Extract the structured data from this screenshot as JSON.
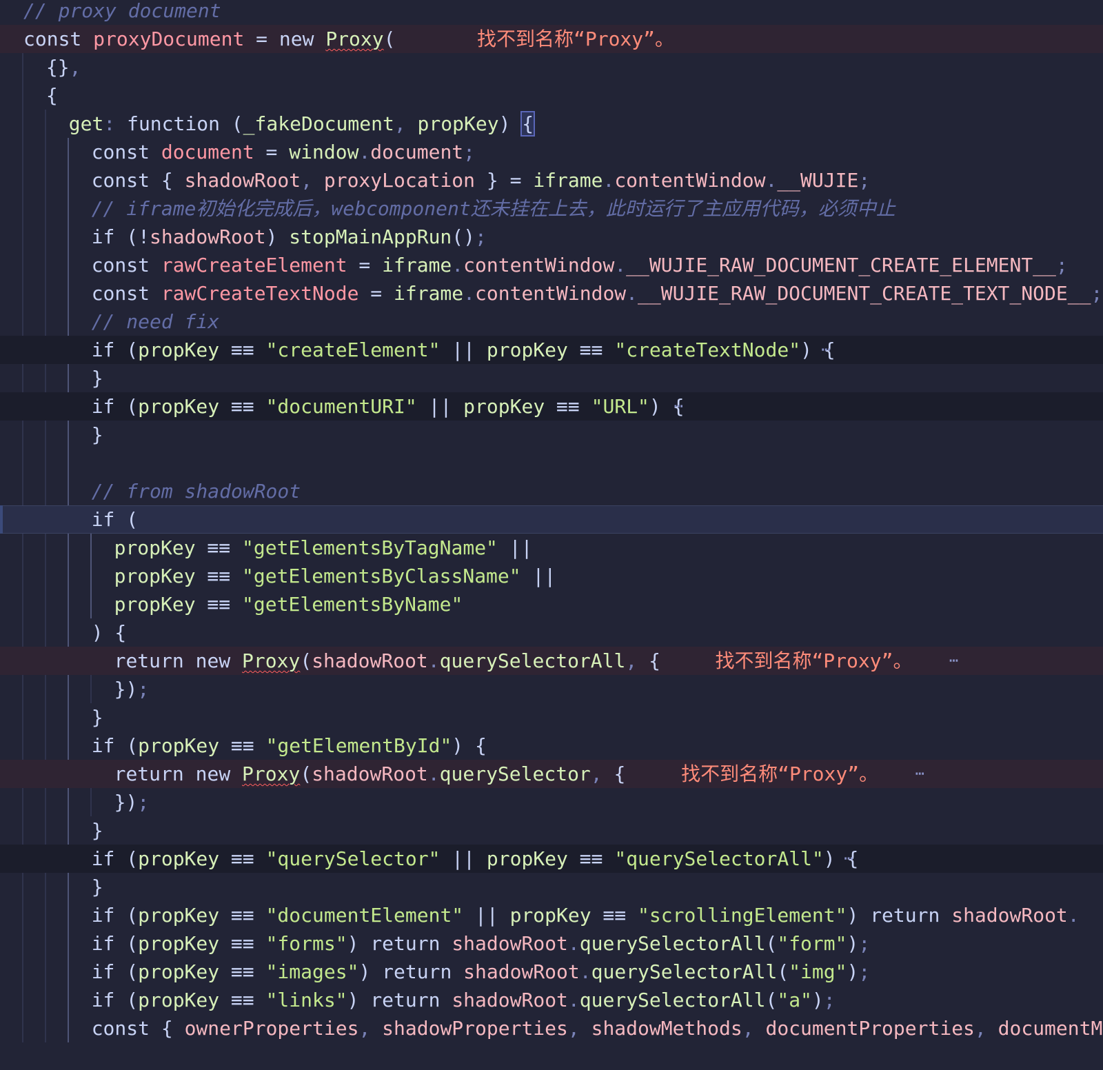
{
  "editor": {
    "language": "javascript",
    "error_message": "找不到名称“Proxy”。",
    "fold_marker": "⋯",
    "lines": [
      {
        "t": "// proxy document"
      },
      {
        "t": "const proxyDocument = new Proxy("
      },
      {
        "t": "{},"
      },
      {
        "t": "{"
      },
      {
        "t": "get: function (_fakeDocument, propKey) {"
      },
      {
        "t": "const document = window.document;"
      },
      {
        "t": "const { shadowRoot, proxyLocation } = iframe.contentWindow.__WUJIE;"
      },
      {
        "t": "// iframe初始化完成后，webcomponent还未挂在上去，此时运行了主应用代码，必须中止"
      },
      {
        "t": "if (!shadowRoot) stopMainAppRun();"
      },
      {
        "t": "const rawCreateElement = iframe.contentWindow.__WUJIE_RAW_DOCUMENT_CREATE_ELEMENT__;"
      },
      {
        "t": "const rawCreateTextNode = iframe.contentWindow.__WUJIE_RAW_DOCUMENT_CREATE_TEXT_NODE__;"
      },
      {
        "t": "// need fix"
      },
      {
        "t": "if (propKey === \"createElement\" || propKey === \"createTextNode\") {"
      },
      {
        "t": "}"
      },
      {
        "t": "if (propKey === \"documentURI\" || propKey === \"URL\") {"
      },
      {
        "t": "}"
      },
      {
        "t": ""
      },
      {
        "t": "// from shadowRoot"
      },
      {
        "t": "if ("
      },
      {
        "t": "propKey === \"getElementsByTagName\" ||"
      },
      {
        "t": "propKey === \"getElementsByClassName\" ||"
      },
      {
        "t": "propKey === \"getElementsByName\""
      },
      {
        "t": ") {"
      },
      {
        "t": "return new Proxy(shadowRoot.querySelectorAll, {"
      },
      {
        "t": "});"
      },
      {
        "t": "}"
      },
      {
        "t": "if (propKey === \"getElementById\") {"
      },
      {
        "t": "return new Proxy(shadowRoot.querySelector, {"
      },
      {
        "t": "});"
      },
      {
        "t": "}"
      },
      {
        "t": "if (propKey === \"querySelector\" || propKey === \"querySelectorAll\") {"
      },
      {
        "t": "}"
      },
      {
        "t": "if (propKey === \"documentElement\" || propKey === \"scrollingElement\") return shadowRoot."
      },
      {
        "t": "if (propKey === \"forms\") return shadowRoot.querySelectorAll(\"form\");"
      },
      {
        "t": "if (propKey === \"images\") return shadowRoot.querySelectorAll(\"img\");"
      },
      {
        "t": "if (propKey === \"links\") return shadowRoot.querySelectorAll(\"a\");"
      },
      {
        "t": "const { ownerProperties, shadowProperties, shadowMethods, documentProperties, documentM"
      }
    ]
  }
}
